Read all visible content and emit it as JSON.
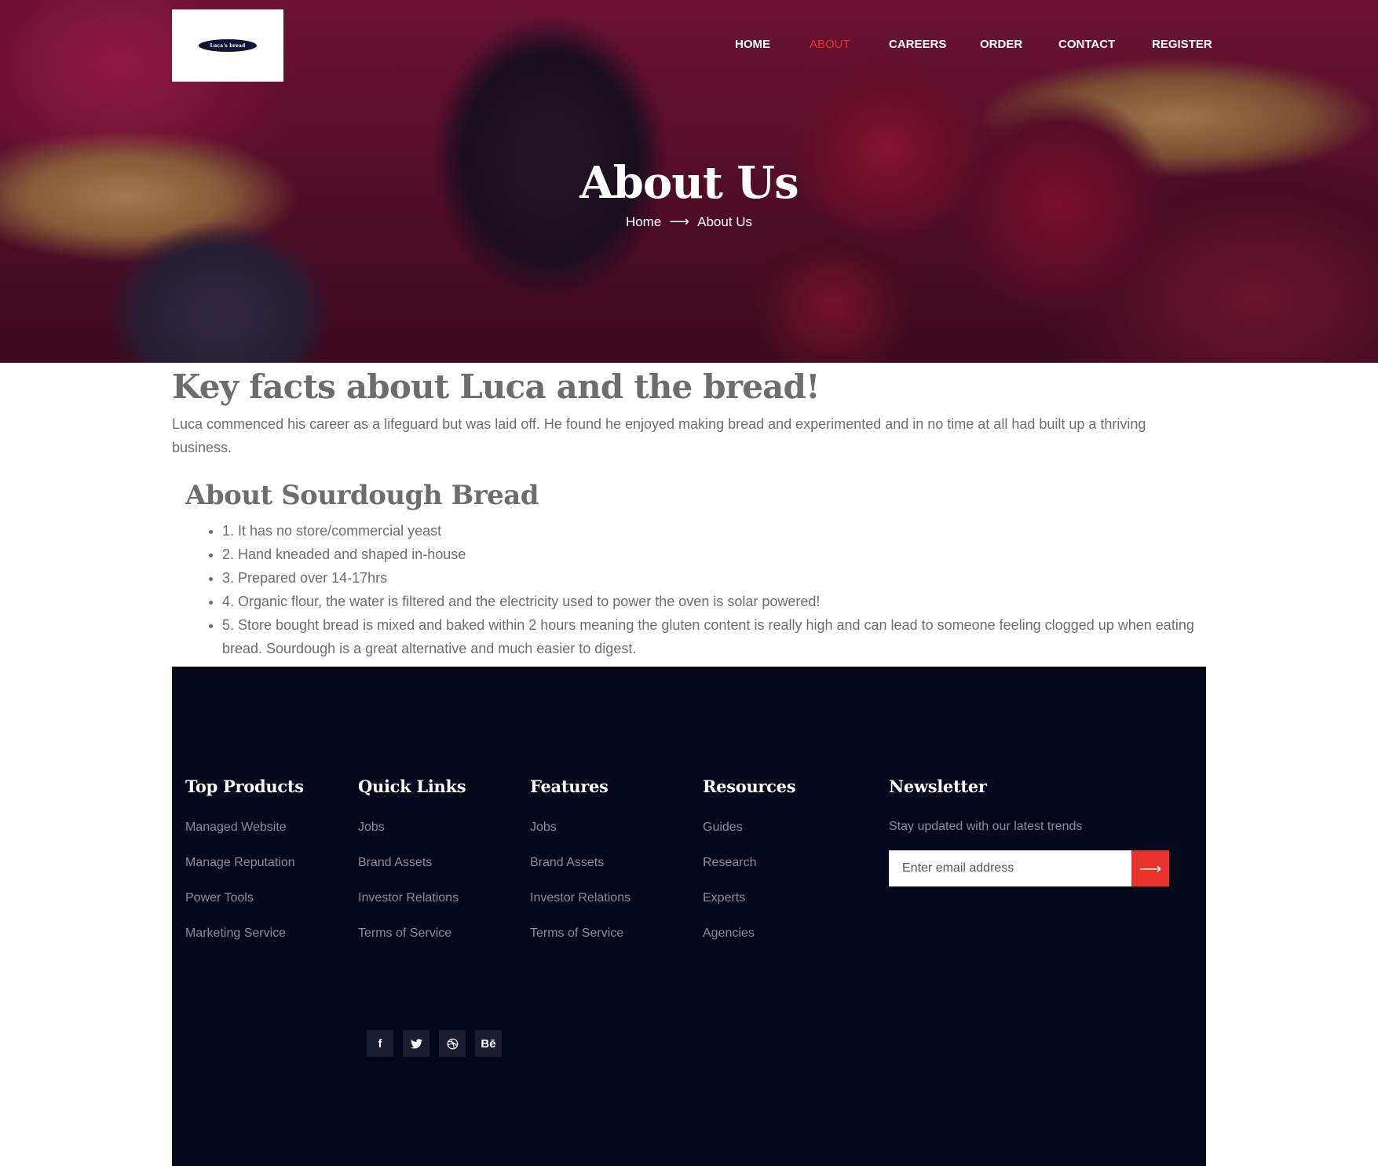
{
  "brand": {
    "logo_text": "Luca's bread"
  },
  "nav": {
    "items": [
      {
        "label": "HOME"
      },
      {
        "label": "ABOUT"
      },
      {
        "label": "CAREERS"
      },
      {
        "label": "ORDER"
      },
      {
        "label": "CONTACT"
      },
      {
        "label": "REGISTER"
      }
    ],
    "active": "ABOUT",
    "active_color": "#e8322b"
  },
  "hero": {
    "title": "About Us",
    "breadcrumb": {
      "home": "Home",
      "current": "About Us"
    }
  },
  "content": {
    "title": "Key facts about Luca and the bread!",
    "intro": "Luca commenced his career as a lifeguard but was laid off. He found he enjoyed making bread and experimented and in no time at all had built up a thriving business.",
    "subtitle": "About Sourdough Bread",
    "facts": [
      "1. It has no store/commercial yeast",
      "2. Hand kneaded and shaped in-house",
      "3. Prepared over 14-17hrs",
      "4. Organic flour, the water is filtered and the electricity used to power the oven is solar powered!",
      "5. Store bought bread is mixed and baked within 2 hours meaning the gluten content is really high and can lead to someone feeling clogged up when eating bread. Sourdough is a great alternative and much easier to digest."
    ]
  },
  "footer": {
    "columns": [
      {
        "title": "Top Products",
        "links": [
          "Managed Website",
          "Manage Reputation",
          "Power Tools",
          "Marketing Service"
        ]
      },
      {
        "title": "Quick Links",
        "links": [
          "Jobs",
          "Brand Assets",
          "Investor Relations",
          "Terms of Service"
        ]
      },
      {
        "title": "Features",
        "links": [
          "Jobs",
          "Brand Assets",
          "Investor Relations",
          "Terms of Service"
        ]
      },
      {
        "title": "Resources",
        "links": [
          "Guides",
          "Research",
          "Experts",
          "Agencies"
        ]
      }
    ],
    "newsletter": {
      "title": "Newsletter",
      "description": "Stay updated with our latest trends",
      "placeholder": "Enter email address",
      "button_icon": "arrow-right-icon"
    },
    "socials": [
      {
        "icon": "facebook-icon",
        "glyph": "f"
      },
      {
        "icon": "twitter-icon",
        "glyph": "🐦"
      },
      {
        "icon": "dribbble-icon",
        "glyph": "⚽"
      },
      {
        "icon": "behance-icon",
        "glyph": "Bē"
      }
    ],
    "background": "#05071c",
    "accent": "#e8322b"
  }
}
